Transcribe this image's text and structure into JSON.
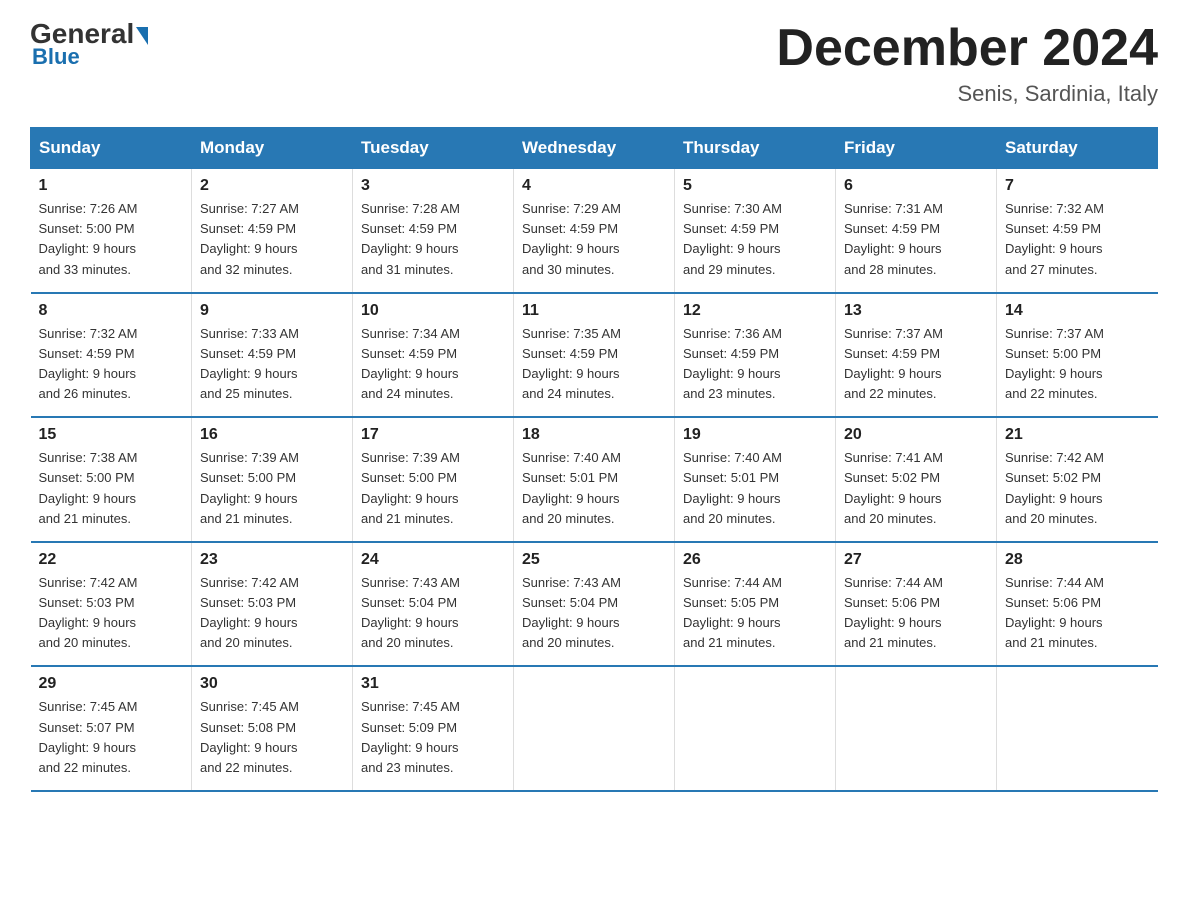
{
  "logo": {
    "part1": "General",
    "part2": "Blue"
  },
  "header": {
    "title": "December 2024",
    "location": "Senis, Sardinia, Italy"
  },
  "days_of_week": [
    "Sunday",
    "Monday",
    "Tuesday",
    "Wednesday",
    "Thursday",
    "Friday",
    "Saturday"
  ],
  "weeks": [
    [
      {
        "day": "1",
        "sunrise": "7:26 AM",
        "sunset": "5:00 PM",
        "daylight": "9 hours and 33 minutes."
      },
      {
        "day": "2",
        "sunrise": "7:27 AM",
        "sunset": "4:59 PM",
        "daylight": "9 hours and 32 minutes."
      },
      {
        "day": "3",
        "sunrise": "7:28 AM",
        "sunset": "4:59 PM",
        "daylight": "9 hours and 31 minutes."
      },
      {
        "day": "4",
        "sunrise": "7:29 AM",
        "sunset": "4:59 PM",
        "daylight": "9 hours and 30 minutes."
      },
      {
        "day": "5",
        "sunrise": "7:30 AM",
        "sunset": "4:59 PM",
        "daylight": "9 hours and 29 minutes."
      },
      {
        "day": "6",
        "sunrise": "7:31 AM",
        "sunset": "4:59 PM",
        "daylight": "9 hours and 28 minutes."
      },
      {
        "day": "7",
        "sunrise": "7:32 AM",
        "sunset": "4:59 PM",
        "daylight": "9 hours and 27 minutes."
      }
    ],
    [
      {
        "day": "8",
        "sunrise": "7:32 AM",
        "sunset": "4:59 PM",
        "daylight": "9 hours and 26 minutes."
      },
      {
        "day": "9",
        "sunrise": "7:33 AM",
        "sunset": "4:59 PM",
        "daylight": "9 hours and 25 minutes."
      },
      {
        "day": "10",
        "sunrise": "7:34 AM",
        "sunset": "4:59 PM",
        "daylight": "9 hours and 24 minutes."
      },
      {
        "day": "11",
        "sunrise": "7:35 AM",
        "sunset": "4:59 PM",
        "daylight": "9 hours and 24 minutes."
      },
      {
        "day": "12",
        "sunrise": "7:36 AM",
        "sunset": "4:59 PM",
        "daylight": "9 hours and 23 minutes."
      },
      {
        "day": "13",
        "sunrise": "7:37 AM",
        "sunset": "4:59 PM",
        "daylight": "9 hours and 22 minutes."
      },
      {
        "day": "14",
        "sunrise": "7:37 AM",
        "sunset": "5:00 PM",
        "daylight": "9 hours and 22 minutes."
      }
    ],
    [
      {
        "day": "15",
        "sunrise": "7:38 AM",
        "sunset": "5:00 PM",
        "daylight": "9 hours and 21 minutes."
      },
      {
        "day": "16",
        "sunrise": "7:39 AM",
        "sunset": "5:00 PM",
        "daylight": "9 hours and 21 minutes."
      },
      {
        "day": "17",
        "sunrise": "7:39 AM",
        "sunset": "5:00 PM",
        "daylight": "9 hours and 21 minutes."
      },
      {
        "day": "18",
        "sunrise": "7:40 AM",
        "sunset": "5:01 PM",
        "daylight": "9 hours and 20 minutes."
      },
      {
        "day": "19",
        "sunrise": "7:40 AM",
        "sunset": "5:01 PM",
        "daylight": "9 hours and 20 minutes."
      },
      {
        "day": "20",
        "sunrise": "7:41 AM",
        "sunset": "5:02 PM",
        "daylight": "9 hours and 20 minutes."
      },
      {
        "day": "21",
        "sunrise": "7:42 AM",
        "sunset": "5:02 PM",
        "daylight": "9 hours and 20 minutes."
      }
    ],
    [
      {
        "day": "22",
        "sunrise": "7:42 AM",
        "sunset": "5:03 PM",
        "daylight": "9 hours and 20 minutes."
      },
      {
        "day": "23",
        "sunrise": "7:42 AM",
        "sunset": "5:03 PM",
        "daylight": "9 hours and 20 minutes."
      },
      {
        "day": "24",
        "sunrise": "7:43 AM",
        "sunset": "5:04 PM",
        "daylight": "9 hours and 20 minutes."
      },
      {
        "day": "25",
        "sunrise": "7:43 AM",
        "sunset": "5:04 PM",
        "daylight": "9 hours and 20 minutes."
      },
      {
        "day": "26",
        "sunrise": "7:44 AM",
        "sunset": "5:05 PM",
        "daylight": "9 hours and 21 minutes."
      },
      {
        "day": "27",
        "sunrise": "7:44 AM",
        "sunset": "5:06 PM",
        "daylight": "9 hours and 21 minutes."
      },
      {
        "day": "28",
        "sunrise": "7:44 AM",
        "sunset": "5:06 PM",
        "daylight": "9 hours and 21 minutes."
      }
    ],
    [
      {
        "day": "29",
        "sunrise": "7:45 AM",
        "sunset": "5:07 PM",
        "daylight": "9 hours and 22 minutes."
      },
      {
        "day": "30",
        "sunrise": "7:45 AM",
        "sunset": "5:08 PM",
        "daylight": "9 hours and 22 minutes."
      },
      {
        "day": "31",
        "sunrise": "7:45 AM",
        "sunset": "5:09 PM",
        "daylight": "9 hours and 23 minutes."
      },
      null,
      null,
      null,
      null
    ]
  ],
  "labels": {
    "sunrise": "Sunrise:",
    "sunset": "Sunset:",
    "daylight": "Daylight:"
  }
}
